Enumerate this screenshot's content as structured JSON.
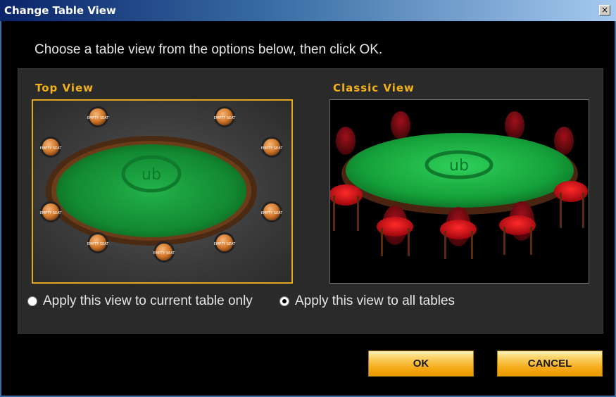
{
  "window": {
    "title": "Change Table View",
    "close_glyph": "×"
  },
  "instruction": "Choose a table view from the options below, then click OK.",
  "views": {
    "top": {
      "label": "Top View",
      "selected": true,
      "seat_text": "EMPTY SEAT",
      "logo_text": "ub"
    },
    "classic": {
      "label": "Classic View",
      "selected": false,
      "logo_text": "ub"
    }
  },
  "apply_options": [
    {
      "label": "Apply this view to current table only",
      "checked": false
    },
    {
      "label": "Apply this view to all tables",
      "checked": true
    }
  ],
  "buttons": {
    "ok": "OK",
    "cancel": "CANCEL"
  },
  "colors": {
    "accent": "#f2b21a",
    "felt": "#1a9a3a",
    "title_bar": "#0a246a"
  }
}
